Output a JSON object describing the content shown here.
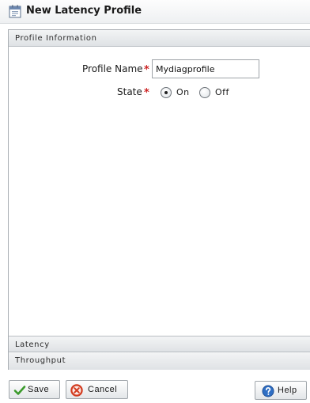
{
  "window": {
    "title": "New Latency Profile",
    "icon": "calendar-document-icon"
  },
  "sections": {
    "profile_information": "Profile Information",
    "latency": "Latency",
    "throughput": "Throughput"
  },
  "form": {
    "profile_name_label": "Profile Name",
    "profile_name_value": "Mydiagprofile",
    "required_marker": "*",
    "state_label": "State",
    "state_options": [
      {
        "label": "On",
        "selected": true
      },
      {
        "label": "Off",
        "selected": false
      }
    ]
  },
  "buttons": {
    "save": "Save",
    "cancel": "Cancel",
    "help": "Help"
  },
  "colors": {
    "required": "#cc2222",
    "save_check": "#3a9a2a",
    "cancel_ring": "#d23a1e",
    "help_circle": "#2f6fc4"
  }
}
